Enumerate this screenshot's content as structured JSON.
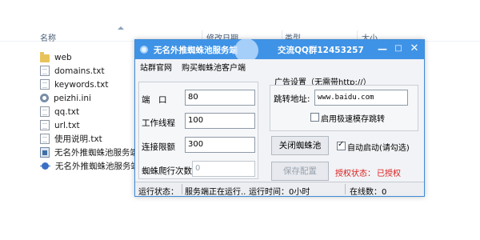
{
  "explorer": {
    "columns": {
      "name": "名称",
      "modified": "修改日期",
      "type": "类型",
      "size": "大小"
    },
    "files": [
      {
        "name": "web",
        "icon": "folder-icon"
      },
      {
        "name": "domains.txt",
        "icon": "text-file-icon"
      },
      {
        "name": "keywords.txt",
        "icon": "text-file-icon"
      },
      {
        "name": "peizhi.ini",
        "icon": "settings-file-icon"
      },
      {
        "name": "qq.txt",
        "icon": "text-file-icon"
      },
      {
        "name": "url.txt",
        "icon": "text-file-icon"
      },
      {
        "name": "使用说明.txt",
        "icon": "text-file-icon"
      },
      {
        "name": "无名外推蜘蛛池服务端V",
        "icon": "app-icon"
      },
      {
        "name": "无名外推蜘蛛池服务端",
        "icon": "spider-app-icon"
      }
    ]
  },
  "window": {
    "title": "无名外推蜘蛛池服务端",
    "qq_group": "交流QQ群12453257",
    "controls": {
      "minimize": "—",
      "maximize": "□",
      "close": "✕"
    },
    "menu": [
      "站群官网",
      "购买蜘蛛池客户端"
    ],
    "settings": {
      "port_label": "端　口",
      "port_value": "80",
      "threads_label": "工作线程",
      "threads_value": "100",
      "conn_limit_label": "连接限额",
      "conn_limit_value": "300",
      "crawl_count_label": "蜘蛛爬行次数",
      "crawl_count_value": "0"
    },
    "ad": {
      "group_title": "广告设置（无需带http://）",
      "redirect_label": "跳转地址:",
      "redirect_value": "www.baidu.com",
      "fast_redirect_label": "启用极速模存跳转",
      "fast_redirect_checked": false
    },
    "actions": {
      "close_spider": "关闭蜘蛛池",
      "autostart_label": "自动启动(请勾选)",
      "autostart_checked": true,
      "save_config": "保存配置",
      "auth_status_label": "授权状态：",
      "auth_status_value": "已授权"
    },
    "status": {
      "run_label": "运行状态：",
      "run_text": "服务端正在运行..",
      "run_time": "运行时间：0小时",
      "online": "在线数：0"
    }
  },
  "colors": {
    "titlebar": "#3f93e6",
    "auth_red": "#d81e1e"
  }
}
